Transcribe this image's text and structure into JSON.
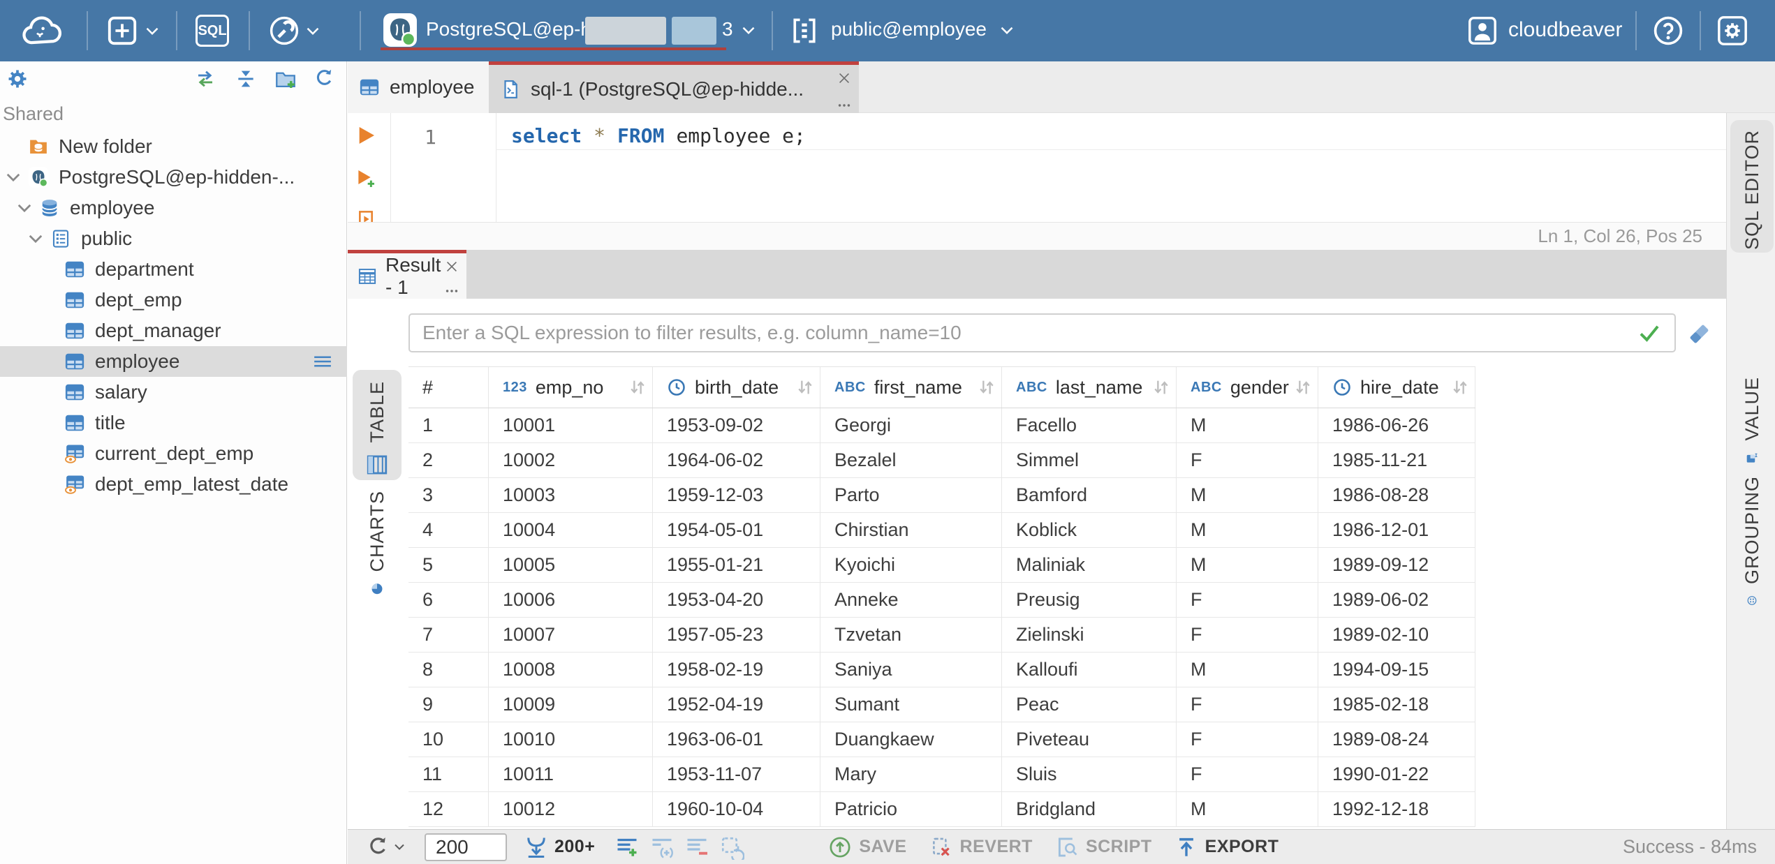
{
  "colors": {
    "topbar_bg": "#4677a6",
    "accent_red": "#c0413e",
    "icon_blue": "#4484c4",
    "exec_orange": "#e8822d",
    "success_green": "#4caf50"
  },
  "topbar": {
    "brand": "cloudbeaver",
    "sql_badge": "SQL",
    "connection": {
      "label": "PostgreSQL@ep-hidde",
      "suffix": "3"
    },
    "schema_selector": "public@employee"
  },
  "sidebar": {
    "section_label": "Shared",
    "tree_items": [
      {
        "label": "New folder"
      },
      {
        "label": "PostgreSQL@ep-hidden-..."
      },
      {
        "label": "employee"
      },
      {
        "label": "public"
      },
      {
        "label": "department"
      },
      {
        "label": "dept_emp"
      },
      {
        "label": "dept_manager"
      },
      {
        "label": "employee"
      },
      {
        "label": "salary"
      },
      {
        "label": "title"
      },
      {
        "label": "current_dept_emp"
      },
      {
        "label": "dept_emp_latest_date"
      }
    ]
  },
  "editor": {
    "tabs": [
      {
        "label": "employee"
      },
      {
        "label": "sql-1 (PostgreSQL@ep-hidde...",
        "overflow": "..."
      }
    ],
    "line_number": "1",
    "code": {
      "kw_select": "select",
      "star": "*",
      "kw_from": "FROM",
      "tail": "employee e;"
    },
    "caret_status": "Ln 1, Col 26, Pos 25"
  },
  "result": {
    "tab_label": "Result - 1",
    "tab_overflow": "...",
    "filter_placeholder": "Enter a SQL expression to filter results, e.g. column_name=10",
    "panel_tabs": {
      "table": "TABLE",
      "charts": "CHARTS"
    },
    "grid": {
      "row_header": "#",
      "columns": [
        {
          "badge": "123",
          "label": "emp_no"
        },
        {
          "badge": "",
          "label": "birth_date"
        },
        {
          "badge": "ABC",
          "label": "first_name"
        },
        {
          "badge": "ABC",
          "label": "last_name"
        },
        {
          "badge": "ABC",
          "label": "gender"
        },
        {
          "badge": "",
          "label": "hire_date"
        }
      ],
      "rows": [
        {
          "num": "1",
          "emp_no": "10001",
          "birth_date": "1953-09-02",
          "first_name": "Georgi",
          "last_name": "Facello",
          "gender": "M",
          "hire_date": "1986-06-26"
        },
        {
          "num": "2",
          "emp_no": "10002",
          "birth_date": "1964-06-02",
          "first_name": "Bezalel",
          "last_name": "Simmel",
          "gender": "F",
          "hire_date": "1985-11-21"
        },
        {
          "num": "3",
          "emp_no": "10003",
          "birth_date": "1959-12-03",
          "first_name": "Parto",
          "last_name": "Bamford",
          "gender": "M",
          "hire_date": "1986-08-28"
        },
        {
          "num": "4",
          "emp_no": "10004",
          "birth_date": "1954-05-01",
          "first_name": "Chirstian",
          "last_name": "Koblick",
          "gender": "M",
          "hire_date": "1986-12-01"
        },
        {
          "num": "5",
          "emp_no": "10005",
          "birth_date": "1955-01-21",
          "first_name": "Kyoichi",
          "last_name": "Maliniak",
          "gender": "M",
          "hire_date": "1989-09-12"
        },
        {
          "num": "6",
          "emp_no": "10006",
          "birth_date": "1953-04-20",
          "first_name": "Anneke",
          "last_name": "Preusig",
          "gender": "F",
          "hire_date": "1989-06-02"
        },
        {
          "num": "7",
          "emp_no": "10007",
          "birth_date": "1957-05-23",
          "first_name": "Tzvetan",
          "last_name": "Zielinski",
          "gender": "F",
          "hire_date": "1989-02-10"
        },
        {
          "num": "8",
          "emp_no": "10008",
          "birth_date": "1958-02-19",
          "first_name": "Saniya",
          "last_name": "Kalloufi",
          "gender": "M",
          "hire_date": "1994-09-15"
        },
        {
          "num": "9",
          "emp_no": "10009",
          "birth_date": "1952-04-19",
          "first_name": "Sumant",
          "last_name": "Peac",
          "gender": "F",
          "hire_date": "1985-02-18"
        },
        {
          "num": "10",
          "emp_no": "10010",
          "birth_date": "1963-06-01",
          "first_name": "Duangkaew",
          "last_name": "Piveteau",
          "gender": "F",
          "hire_date": "1989-08-24"
        },
        {
          "num": "11",
          "emp_no": "10011",
          "birth_date": "1953-11-07",
          "first_name": "Mary",
          "last_name": "Sluis",
          "gender": "F",
          "hire_date": "1990-01-22"
        },
        {
          "num": "12",
          "emp_no": "10012",
          "birth_date": "1960-10-04",
          "first_name": "Patricio",
          "last_name": "Bridgland",
          "gender": "M",
          "hire_date": "1992-12-18"
        }
      ]
    },
    "toolbar": {
      "row_limit_value": "200",
      "fetch_more_label": "200+",
      "save_label": "SAVE",
      "revert_label": "REVERT",
      "script_label": "SCRIPT",
      "export_label": "EXPORT",
      "status": "Success - 84ms"
    }
  },
  "right_panel": {
    "sql_editor_tab": "SQL EDITOR",
    "value_tab": "VALUE",
    "grouping_tab": "GROUPING"
  }
}
